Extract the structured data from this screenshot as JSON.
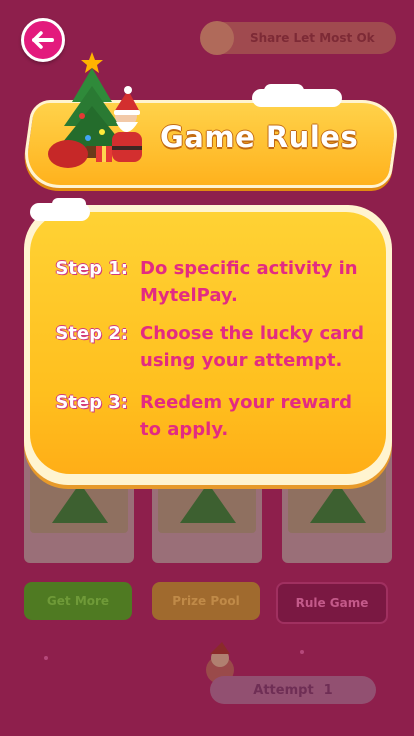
{
  "back_button": {
    "icon": "arrow-left-icon"
  },
  "background": {
    "share_text": "Share Let Most Ok",
    "buttons": [
      {
        "label": "Get More",
        "color": "#5f8a2a",
        "text_color": "#3f6a18"
      },
      {
        "label": "Prize Pool",
        "color": "#b0793a",
        "text_color": "#8f5a20"
      },
      {
        "label": "Rule Game",
        "color": "#8a2050",
        "text_color": "#c45a8a"
      }
    ],
    "attempt_label": "Attempt",
    "attempt_count": "1"
  },
  "title": "Game Rules",
  "rules": [
    {
      "label": "Step 1:",
      "text": "Do specific activity in MytelPay."
    },
    {
      "label": "Step 2:",
      "text": "Choose the lucky card using your attempt."
    },
    {
      "label": "Step 3:",
      "text": "Reedem your reward to apply."
    }
  ],
  "colors": {
    "overlay_bg": "#8e1f4c",
    "accent_pink": "#e32b82",
    "banner_yellow": "#ffc21f"
  }
}
